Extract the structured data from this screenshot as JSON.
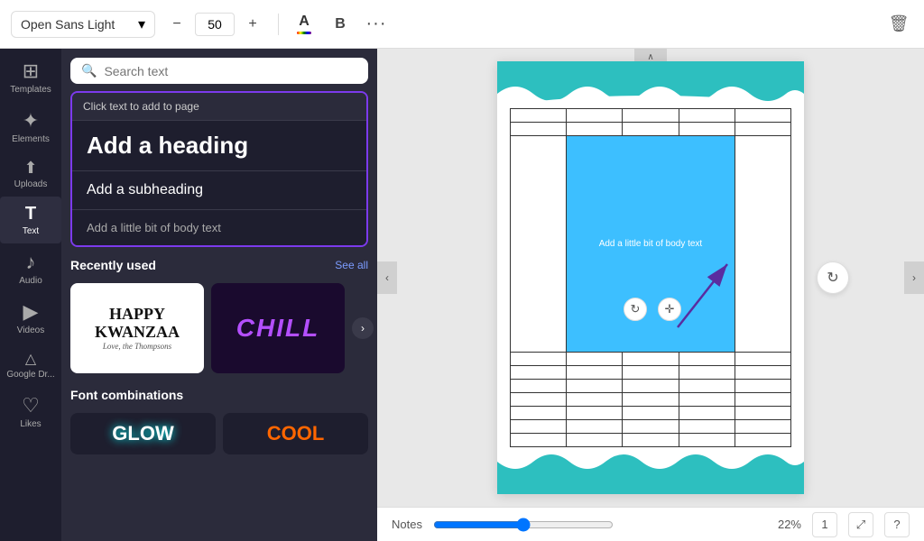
{
  "toolbar": {
    "font_name": "Open Sans Light",
    "font_size": "50",
    "text_color_label": "A",
    "bold_label": "B",
    "more_label": "···",
    "minus_label": "−",
    "plus_label": "+",
    "trash_label": "🗑"
  },
  "sidebar": {
    "items": [
      {
        "id": "templates",
        "label": "Templates",
        "icon": "⊞"
      },
      {
        "id": "elements",
        "label": "Elements",
        "icon": "✦"
      },
      {
        "id": "uploads",
        "label": "Uploads",
        "icon": "↑"
      },
      {
        "id": "text",
        "label": "Text",
        "icon": "T",
        "active": true
      },
      {
        "id": "audio",
        "label": "Audio",
        "icon": "♪"
      },
      {
        "id": "videos",
        "label": "Videos",
        "icon": "▶"
      },
      {
        "id": "googledrive",
        "label": "Google Dr...",
        "icon": "△"
      },
      {
        "id": "likes",
        "label": "Likes",
        "icon": "♡"
      }
    ]
  },
  "text_panel": {
    "search_placeholder": "Search text",
    "click_to_add_label": "Click text to add to page",
    "heading_label": "Add a heading",
    "subheading_label": "Add a subheading",
    "body_label": "Add a little bit of body text",
    "recently_used_title": "Recently used",
    "see_all_label": "See all",
    "font_combinations_title": "Font combinations",
    "template1_line1": "HAPPY",
    "template1_line2": "KWANZAA",
    "template1_line3": "Love, the Thompsons",
    "template2_text": "CHILL",
    "font_combo1": "GLOW",
    "font_combo2": "COOL"
  },
  "canvas": {
    "selected_text": "Add a little bit of body text",
    "notes_label": "Notes",
    "zoom_label": "22%",
    "page_number": "1"
  },
  "icons": {
    "search": "🔍",
    "chevron_down": "▾",
    "rotate": "↻",
    "move": "✛",
    "question": "?",
    "fullscreen": "⤢",
    "chevron_up": "∧",
    "chevron_left": "‹",
    "chevron_right": "›",
    "chevron_down_small": "∨"
  }
}
